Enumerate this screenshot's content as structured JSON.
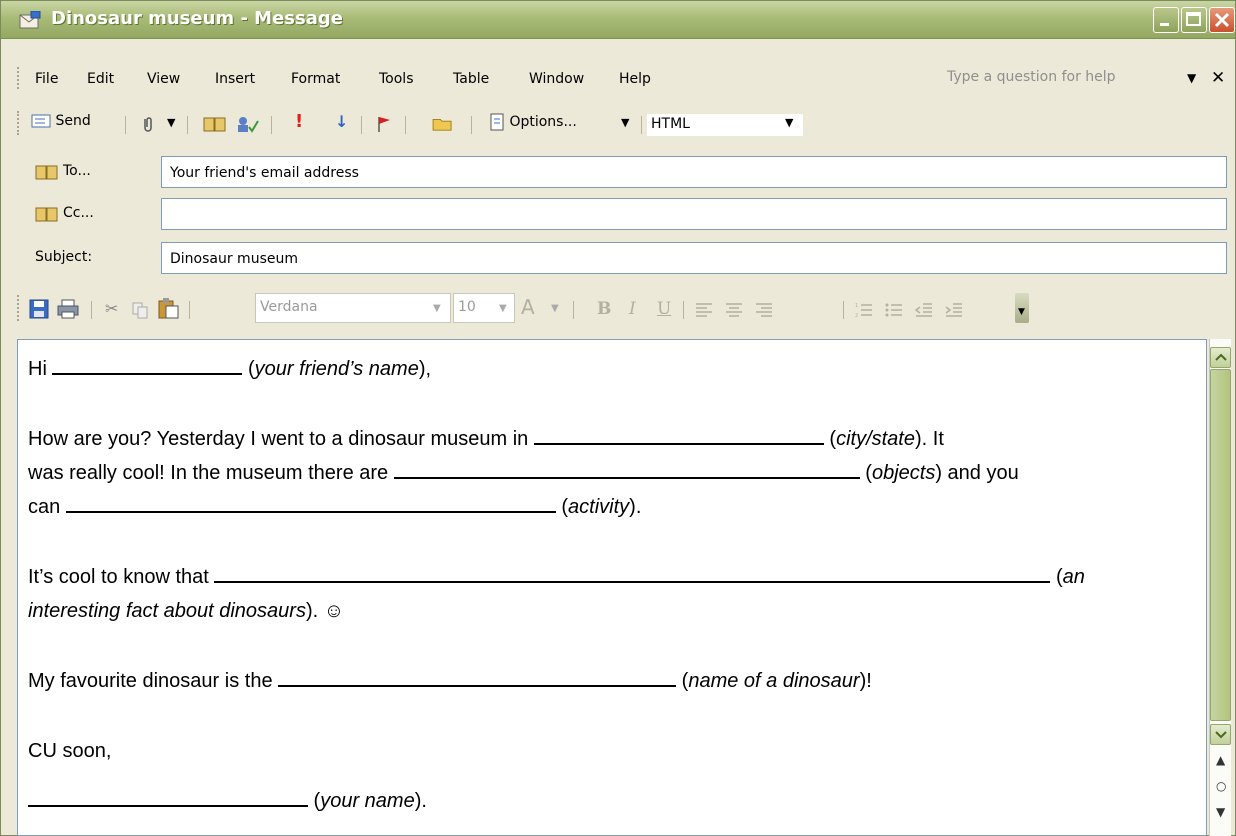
{
  "window": {
    "title": "Dinosaur museum - Message",
    "title_icon": "envelope-icon"
  },
  "menu": {
    "items": [
      "File",
      "Edit",
      "View",
      "Insert",
      "Format",
      "Tools",
      "Table",
      "Window",
      "Help"
    ],
    "help_placeholder": "Type a question for help"
  },
  "toolbar": {
    "send": "Send",
    "options": "Options...",
    "format": "HTML"
  },
  "fields": {
    "to_label": "To...",
    "to_value": "Your friend's email address",
    "cc_label": "Cc...",
    "cc_value": "",
    "subject_label": "Subject:",
    "subject_value": "Dinosaur museum"
  },
  "format_toolbar": {
    "font": "Verdana",
    "size": "10"
  },
  "message": {
    "line1_a": "Hi ",
    "line1_hint": "your friend’s name",
    "line2_a": "How are you? Yesterday I went to a dinosaur museum in ",
    "line2_hint": "city/state",
    "line2_b": "). It",
    "line3_a": "was really cool! In the museum there are ",
    "line3_hint": "objects",
    "line3_b": ") and you",
    "line4_a": "can ",
    "line4_hint": "activity",
    "line5_a": "It’s cool to know that ",
    "line5_hint": "an",
    "line6_hint": "interesting fact about dinosaurs",
    "line6_b": "). ☺",
    "line7_a": "My favourite dinosaur is the ",
    "line7_hint": "name of a dinosaur",
    "line7_b": ")!",
    "line8": "CU soon,",
    "line9_hint": "your name"
  }
}
